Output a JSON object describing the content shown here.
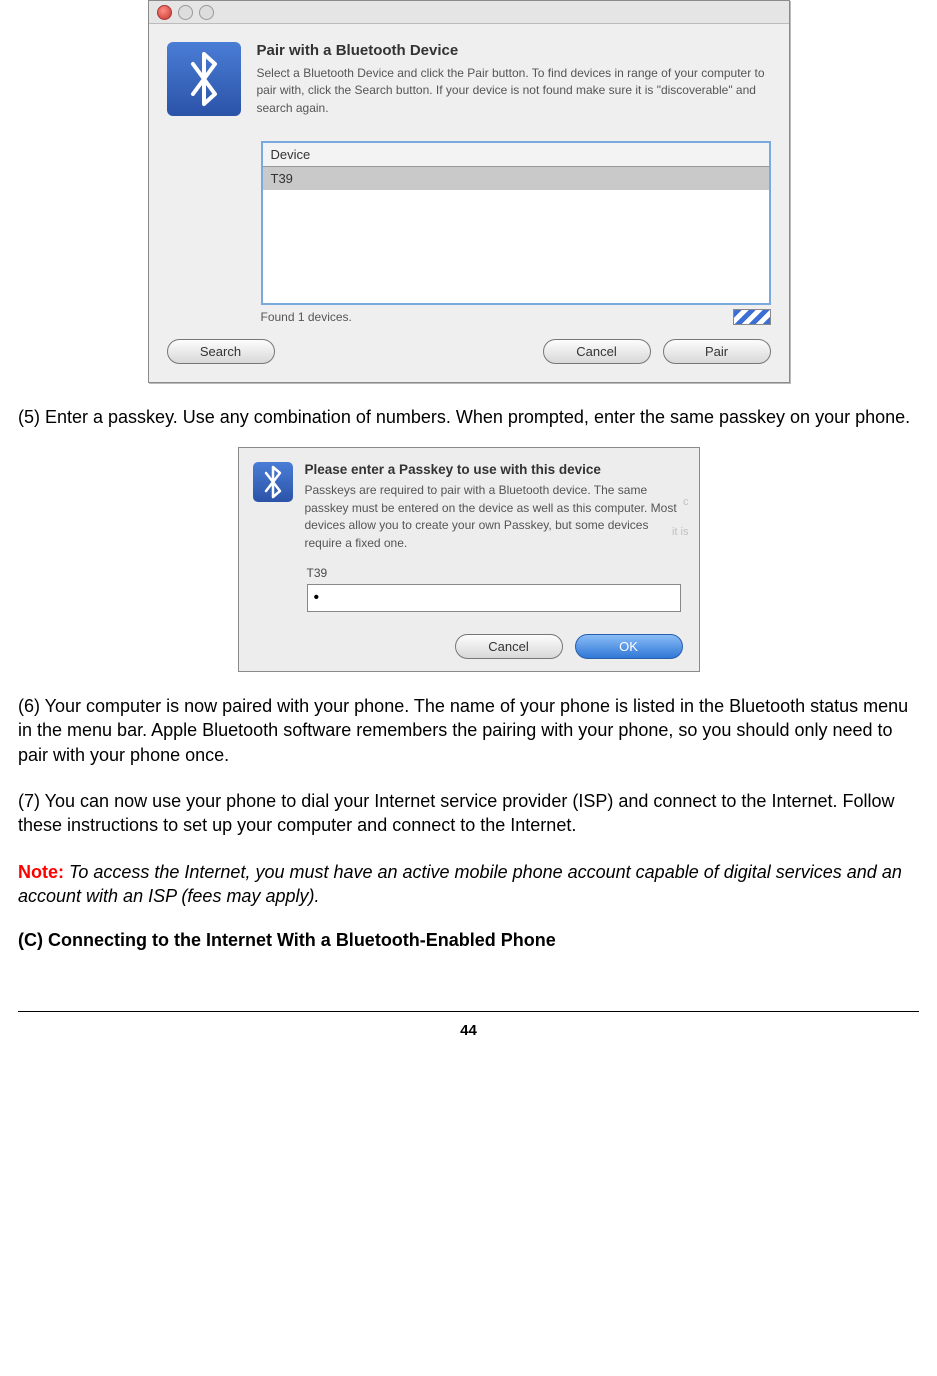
{
  "dialog1": {
    "title": "Pair with a Bluetooth Device",
    "description": "Select a Bluetooth Device and click the Pair button. To find devices in range of your computer to pair with, click the Search button. If your device is not found make sure it is \"discoverable\" and search again.",
    "device_header": "Device",
    "device_row": "T39",
    "found_text": "Found 1 devices.",
    "buttons": {
      "search": "Search",
      "cancel": "Cancel",
      "pair": "Pair"
    }
  },
  "step5": "(5) Enter a passkey. Use any combination of numbers. When prompted, enter the same passkey on your phone.",
  "dialog2": {
    "title": "Please enter a Passkey to use with this device",
    "description": "Passkeys are required to pair with a Bluetooth device.  The same passkey must be entered on the device as well as this computer. Most devices allow you to create your own Passkey, but some devices require a fixed one.",
    "device_name": "T39",
    "pass_value": "•",
    "buttons": {
      "cancel": "Cancel",
      "ok": "OK"
    },
    "ghost1": "c",
    "ghost2": "it is"
  },
  "step6": "(6) Your computer is now paired with your phone. The name of your phone is listed in the Bluetooth status menu in the menu bar. Apple Bluetooth software remembers the pairing with your phone, so you should only need to pair with your phone once.",
  "step7": "(7) You can now use your phone to dial your Internet service provider (ISP) and connect to the Internet. Follow these instructions to set up your computer and connect to the Internet.",
  "note_label": "Note:",
  "note_text": " To access the Internet, you must have an active mobile phone account capable of digital services and an account with an ISP (fees may apply).",
  "section_c": "(C) Connecting to the Internet With a Bluetooth-Enabled Phone",
  "page_number": "44"
}
